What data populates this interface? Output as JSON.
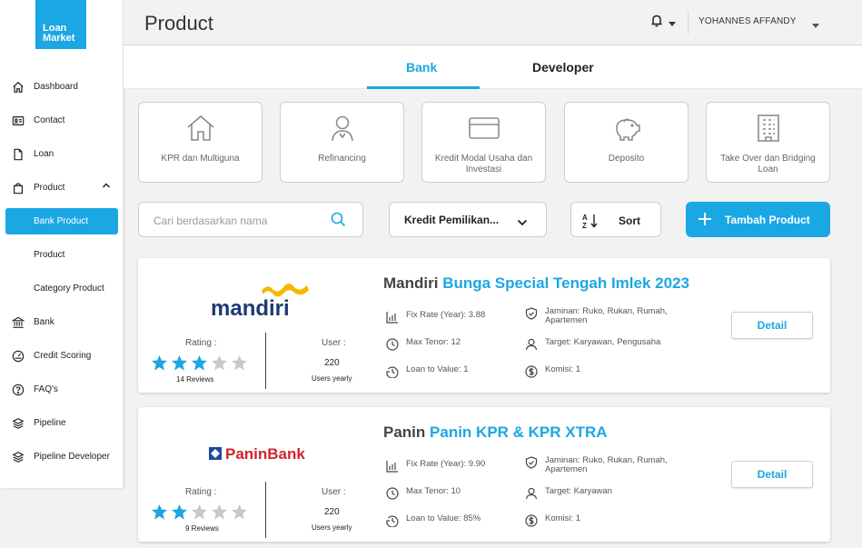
{
  "brand": {
    "logo_line1": "Loan",
    "logo_line2": "Market",
    "accent": "#1ba7e3"
  },
  "sidebar": {
    "items": [
      {
        "label": "Dashboard",
        "icon": "home-icon"
      },
      {
        "label": "Contact",
        "icon": "contact-card-icon"
      },
      {
        "label": "Loan",
        "icon": "document-icon"
      },
      {
        "label": "Product",
        "icon": "bag-icon",
        "expanded": true
      },
      {
        "label": "Bank Product",
        "sub": true,
        "active": true
      },
      {
        "label": "Product",
        "sub": true
      },
      {
        "label": "Category Product",
        "sub": true
      },
      {
        "label": "Bank",
        "icon": "bank-icon"
      },
      {
        "label": "Credit Scoring",
        "icon": "gauge-icon"
      },
      {
        "label": "FAQ's",
        "icon": "help-icon"
      },
      {
        "label": "Pipeline",
        "icon": "layers-icon"
      },
      {
        "label": "Pipeline Developer",
        "icon": "layers-icon"
      }
    ]
  },
  "header": {
    "title": "Product",
    "user": "YOHANNES AFFANDY"
  },
  "tabs": [
    {
      "label": "Bank",
      "active": true
    },
    {
      "label": "Developer",
      "active": false
    }
  ],
  "categories": [
    {
      "label": "KPR dan Multiguna",
      "icon": "house-icon"
    },
    {
      "label": "Refinancing",
      "icon": "person-icon"
    },
    {
      "label": "Kredit Modal Usaha dan Investasi",
      "icon": "card-icon"
    },
    {
      "label": "Deposito",
      "icon": "piggy-bank-icon"
    },
    {
      "label": "Take Over dan Bridging Loan",
      "icon": "building-icon"
    }
  ],
  "toolbar": {
    "search_placeholder": "Cari berdasarkan nama",
    "filter_value": "Kredit Pemilikan...",
    "sort_label": "Sort",
    "add_label": "Tambah Product"
  },
  "products": [
    {
      "bank": "Mandiri",
      "name": "Bunga Special Tengah Imlek 2023",
      "logo_text": "mandiri",
      "rating_label": "Rating :",
      "rating": 3,
      "reviews": "14 Reviews",
      "user_label": "User :",
      "users": "220",
      "users_sub": "Users yearly",
      "fix_rate": "Fix Rate (Year): 3.88",
      "max_tenor": "Max Tenor: 12",
      "ltv": "Loan to Value: 1",
      "jaminan": "Jaminan: Ruko, Rukan, Rumah, Apartemen",
      "target": "Target: Karyawan, Pengusaha",
      "komisi": "Komisi: 1",
      "detail_label": "Detail"
    },
    {
      "bank": "Panin",
      "name": "Panin KPR & KPR XTRA",
      "logo_text": "PaninBank",
      "rating_label": "Rating :",
      "rating": 2,
      "reviews": "9 Reviews",
      "user_label": "User :",
      "users": "220",
      "users_sub": "Users yearly",
      "fix_rate": "Fix Rate (Year): 9.90",
      "max_tenor": "Max Tenor: 10",
      "ltv": "Loan to Value: 85%",
      "jaminan": "Jaminan: Ruko, Rukan, Rumah, Apartemen",
      "target": "Target: Karyawan",
      "komisi": "Komisi: 1",
      "detail_label": "Detail"
    }
  ]
}
